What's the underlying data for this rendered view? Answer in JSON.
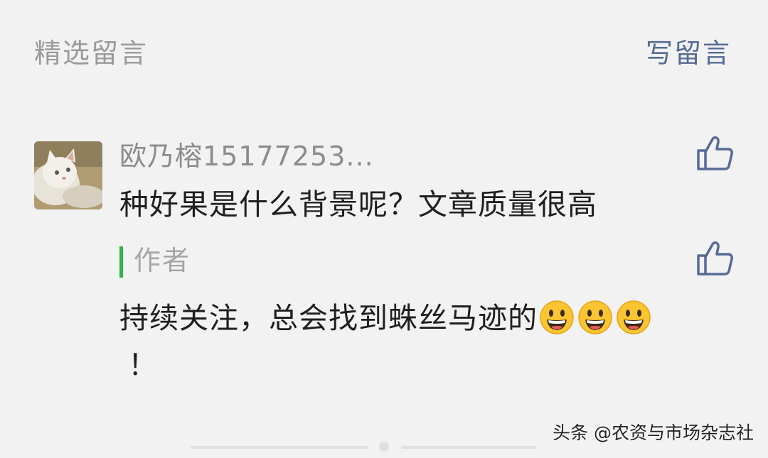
{
  "header": {
    "title": "精选留言",
    "write_label": "写留言"
  },
  "comment": {
    "username": "欧乃榕15177253...",
    "text": "种好果是什么背景呢？文章质量很高"
  },
  "reply": {
    "author_label": "作者",
    "text": "持续关注，总会找到蛛丝马迹的",
    "emoji_count": 3,
    "ending": "！"
  },
  "watermark": "头条 @农资与市场杂志社",
  "icons": {
    "like": "thumbs-up-icon",
    "emoji": "grinning-face-icon",
    "avatar": "cat-avatar"
  },
  "colors": {
    "background": "#f2f2f2",
    "link": "#576b95",
    "reply_bar": "#32b149"
  }
}
